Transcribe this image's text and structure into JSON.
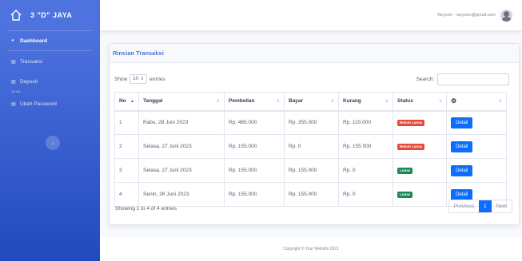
{
  "brand": {
    "name": "3 \"D\" JAYA",
    "icon": "house-outline-icon"
  },
  "sidebar": {
    "items": [
      {
        "label": "Dashboard",
        "icon": "gauge-icon",
        "active": true
      },
      {
        "label": "Transaksi",
        "icon": "document-icon"
      },
      {
        "label": "Deposit",
        "icon": "document-icon"
      },
      {
        "label": "Ubah Password",
        "icon": "document-icon"
      }
    ],
    "heading": "AKUN",
    "toggle_icon": "chevron-left-icon"
  },
  "topbar": {
    "user_email": "Taryoon - taryoon@gmail.com"
  },
  "card": {
    "title": "Rincian Transaksi"
  },
  "table_controls": {
    "show_label": "Show",
    "page_length": "10",
    "entries_label": "entries",
    "search_label": "Search:"
  },
  "table": {
    "headers": [
      "No",
      "Tanggal",
      "Pembelian",
      "Bayar",
      "Kurang",
      "Status"
    ],
    "rows": [
      {
        "no": "1",
        "tanggal": "Rabu, 28 Juni 2023",
        "pembelian": "Rp. 465.000",
        "bayar": "Rp. 355.000",
        "kurang": "Rp. 110.000",
        "status": "Belum Lunas",
        "action": "Detail"
      },
      {
        "no": "2",
        "tanggal": "Selasa, 27 Juni 2023",
        "pembelian": "Rp. 155.000",
        "bayar": "Rp. 0",
        "kurang": "Rp. 155.000",
        "status": "Belum Lunas",
        "action": "Detail"
      },
      {
        "no": "3",
        "tanggal": "Selasa, 27 Juni 2023",
        "pembelian": "Rp. 155.000",
        "bayar": "Rp. 155.000",
        "kurang": "Rp. 0",
        "status": "Lunas",
        "action": "Detail"
      },
      {
        "no": "4",
        "tanggal": "Senin, 26 Juni 2023",
        "pembelian": "Rp. 155.000",
        "bayar": "Rp. 155.000",
        "kurang": "Rp. 0",
        "status": "Lunas",
        "action": "Detail"
      }
    ]
  },
  "pagination": {
    "info": "Showing 1 to 4 of 4 entries",
    "previous": "Previous",
    "current": "1",
    "next": "Next"
  },
  "footer": {
    "copyright": "Copyright © Your Website 2021"
  },
  "colors": {
    "primary": "#4e73df",
    "button": "#0d6efd",
    "unpaid": "#e74a3b",
    "paid": "#1a8754"
  }
}
